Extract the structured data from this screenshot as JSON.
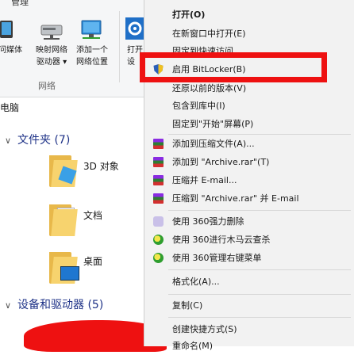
{
  "ribbon": {
    "tab_hint": "管理",
    "buttons": [
      {
        "label": "问媒体"
      },
      {
        "label": "映射网络\n驱动器 ▾"
      },
      {
        "label": "添加一个\n网络位置"
      },
      {
        "label": "打开\n设"
      }
    ],
    "group_label": "网络"
  },
  "address": {
    "text": "电脑"
  },
  "sections": [
    {
      "title": "文件夹 (7)"
    },
    {
      "title": "设备和驱动器 (5)"
    }
  ],
  "folders": [
    {
      "label": "3D 对象"
    },
    {
      "label": "文档"
    },
    {
      "label": "桌面"
    }
  ],
  "context_menu": {
    "items": [
      {
        "label": "打开(O)",
        "icon": "none"
      },
      {
        "label": "在新窗口中打开(E)",
        "icon": "none"
      },
      {
        "label": "固定到快速访问",
        "icon": "none"
      },
      {
        "label": "启用 BitLocker(B)",
        "icon": "shield-icon"
      },
      {
        "label": "还原以前的版本(V)",
        "icon": "none"
      },
      {
        "label": "包含到库中(I)",
        "icon": "none"
      },
      {
        "label": "固定到\"开始\"屏幕(P)",
        "icon": "none"
      },
      {
        "label": "添加到压缩文件(A)...",
        "icon": "winrar-icon"
      },
      {
        "label": "添加到 \"Archive.rar\"(T)",
        "icon": "winrar-icon"
      },
      {
        "label": "压缩并 E-mail...",
        "icon": "winrar-icon"
      },
      {
        "label": "压缩到 \"Archive.rar\" 并 E-mail",
        "icon": "winrar-icon"
      },
      {
        "label": "使用 360强力删除",
        "icon": "360-shred-icon"
      },
      {
        "label": "使用 360进行木马云查杀",
        "icon": "360-scan-icon"
      },
      {
        "label": "使用 360管理右键菜单",
        "icon": "360-scan-icon"
      },
      {
        "label": "格式化(A)...",
        "icon": "none"
      },
      {
        "label": "复制(C)",
        "icon": "none"
      },
      {
        "label": "创建快捷方式(S)",
        "icon": "none"
      },
      {
        "label": "重命名(M)",
        "icon": "none"
      }
    ]
  },
  "colors": {
    "highlight": "#ee1111",
    "menu_bg": "#f2f2f2",
    "section_title": "#1e3287"
  }
}
